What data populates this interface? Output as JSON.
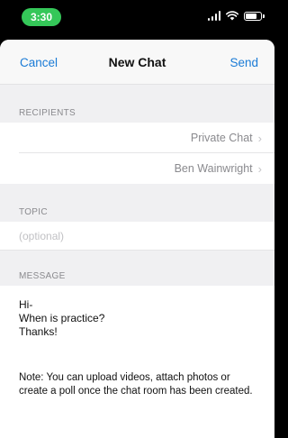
{
  "status_bar": {
    "time": "3:30",
    "icons": [
      "signal-icon",
      "wifi-icon",
      "battery-icon"
    ]
  },
  "nav": {
    "cancel_label": "Cancel",
    "title": "New Chat",
    "send_label": "Send"
  },
  "recipients": {
    "header": "RECIPIENTS",
    "rows": [
      {
        "label": "Private Chat"
      },
      {
        "label": "Ben Wainwright"
      }
    ]
  },
  "topic": {
    "header": "TOPIC",
    "placeholder": "(optional)"
  },
  "message": {
    "header": "MESSAGE",
    "lines": [
      "Hi-",
      "When is practice?",
      "Thanks!"
    ],
    "note": "Note: You can upload videos, attach photos or create a poll once the chat room has been created."
  },
  "colors": {
    "accent": "#1a7bd6",
    "time_pill": "#35c759",
    "section_bg": "#f0f0f2"
  }
}
